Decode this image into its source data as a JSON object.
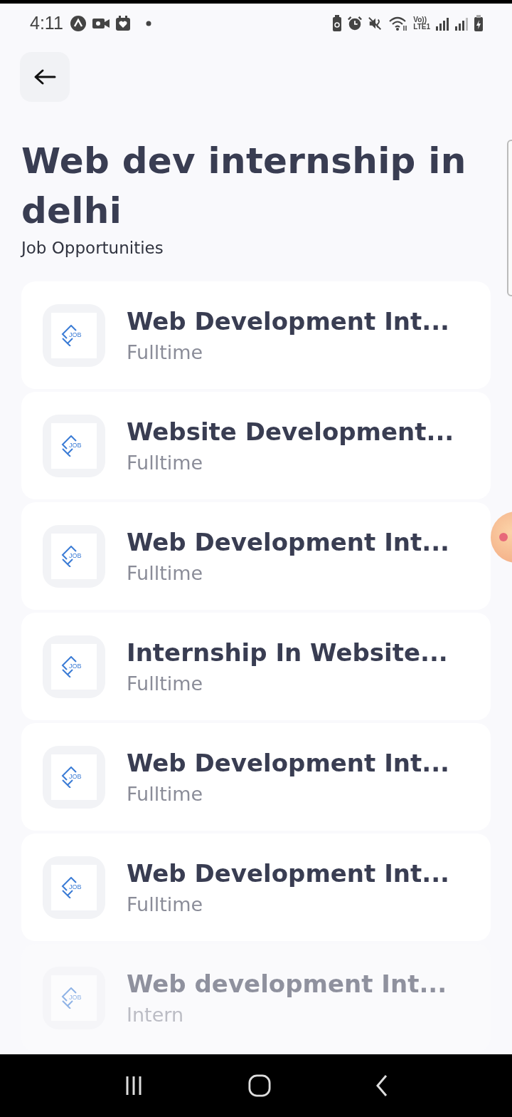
{
  "status_bar": {
    "time": "4:11",
    "network_label_top": "Vo))",
    "network_label_bottom": "LTE1"
  },
  "header": {
    "title": "Web dev internship in delhi",
    "subtitle": "Job Opportunities"
  },
  "jobs": [
    {
      "title": "Web Development Int...",
      "type": "Fulltime",
      "logo_text": "JOB",
      "faded": false
    },
    {
      "title": "Website Development...",
      "type": "Fulltime",
      "logo_text": "JOB",
      "faded": false
    },
    {
      "title": "Web Development Int...",
      "type": "Fulltime",
      "logo_text": "JOB",
      "faded": false
    },
    {
      "title": "Internship In Website...",
      "type": "Fulltime",
      "logo_text": "JOB",
      "faded": false
    },
    {
      "title": "Web Development Int...",
      "type": "Fulltime",
      "logo_text": "JOB",
      "faded": false
    },
    {
      "title": "Web Development Int...",
      "type": "Fulltime",
      "logo_text": "JOB",
      "faded": false
    },
    {
      "title": "Web development Int...",
      "type": "Intern",
      "logo_text": "JOB",
      "faded": true
    }
  ]
}
